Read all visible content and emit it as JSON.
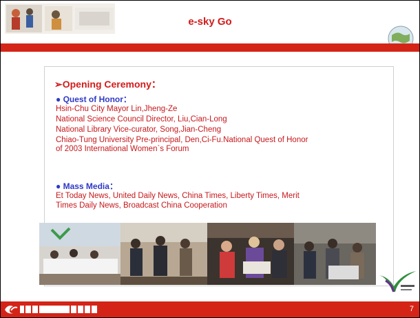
{
  "header": {
    "title": "e-sky Go"
  },
  "content": {
    "section_title": "➢Opening Ceremony：",
    "quest_heading": "● Quest of Honor：",
    "quest_lines": [
      "Hsin-Chu City Mayor Lin,Jheng-Ze",
      "National Science Council Director, Liu,Cian-Long",
      "National Library Vice-curator, Song,Jian-Cheng",
      "Chiao-Tung University Pre-principal, Den,Ci-Fu.National Quest of Honor",
      "of 2003 International Women`s Forum"
    ],
    "media_heading": "● Mass Media：",
    "media_lines": [
      "Et Today News, United Daily News, China Times, Liberty Times, Merit",
      "Times Daily News, Broadcast China Cooperation"
    ]
  },
  "footer": {
    "page_number": "7"
  },
  "colors": {
    "accent_red": "#d42418",
    "heading_blue": "#2e39c4",
    "text_red": "#c5181c"
  }
}
